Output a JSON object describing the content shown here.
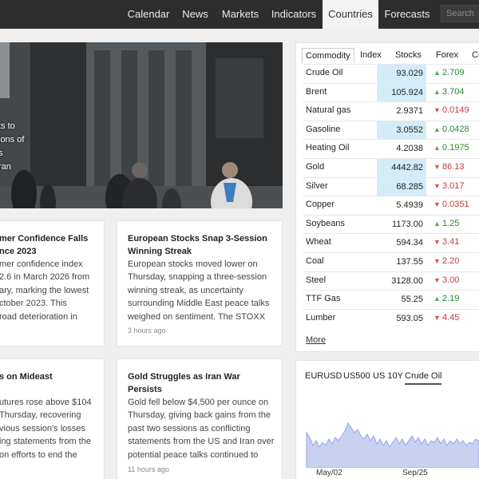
{
  "nav": {
    "items": [
      "Calendar",
      "News",
      "Markets",
      "Indicators",
      "Countries",
      "Forecasts"
    ],
    "active": "Countries",
    "search_placeholder": "Search"
  },
  "hero": {
    "overlay_lines": [
      "ts to",
      "ions of",
      "s",
      "ran"
    ]
  },
  "cards": [
    {
      "title": "mer Confidence Falls\nnce 2023",
      "body": "mer confidence index\n2.6 in March 2026 from\nary, marking the lowest\nctober 2023. This\nroad deterioration in",
      "time": ""
    },
    {
      "title": "European Stocks Snap 3-Session\nWinning Streak",
      "body": "European stocks moved lower on\nThursday, snapping a three-session\nwinning streak, as uncertainty\nsurrounding Middle East peace talks\nweighed on sentiment. The STOXX",
      "time": "3 hours ago"
    },
    {
      "title": "s on Mideast",
      "body": "utures rose above $104\nThursday, recovering\nvious session's losses\ning statements from the\non efforts to end the",
      "time": ""
    },
    {
      "title": "Gold Struggles as Iran War\nPersists",
      "body": "Gold fell below $4,500 per ounce on\nThursday, giving back gains from the\npast two sessions as conflicting\nstatements from the US and Iran over\npotential peace talks continued to",
      "time": "11 hours ago"
    }
  ],
  "commodities": {
    "tabs": [
      "Commodity",
      "Index",
      "Stocks",
      "Forex",
      "Cr"
    ],
    "active_tab": "Commodity",
    "rows": [
      {
        "name": "Crude Oil",
        "price": "93.029",
        "change": "2.709",
        "direction": "up",
        "highlight": true
      },
      {
        "name": "Brent",
        "price": "105.924",
        "change": "3.704",
        "direction": "up",
        "highlight": true
      },
      {
        "name": "Natural gas",
        "price": "2.9371",
        "change": "0.0149",
        "direction": "down",
        "highlight": false
      },
      {
        "name": "Gasoline",
        "price": "3.0552",
        "change": "0.0428",
        "direction": "up",
        "highlight": true
      },
      {
        "name": "Heating Oil",
        "price": "4.2038",
        "change": "0.1975",
        "direction": "up",
        "highlight": false
      },
      {
        "name": "Gold",
        "price": "4442.82",
        "change": "86.13",
        "direction": "down",
        "highlight": true
      },
      {
        "name": "Silver",
        "price": "68.285",
        "change": "3.017",
        "direction": "down",
        "highlight": true
      },
      {
        "name": "Copper",
        "price": "5.4939",
        "change": "0.0351",
        "direction": "down",
        "highlight": false
      },
      {
        "name": "Soybeans",
        "price": "1173.00",
        "change": "1.25",
        "direction": "up",
        "highlight": false
      },
      {
        "name": "Wheat",
        "price": "594.34",
        "change": "3.41",
        "direction": "down",
        "highlight": false
      },
      {
        "name": "Coal",
        "price": "137.55",
        "change": "2.20",
        "direction": "down",
        "highlight": false
      },
      {
        "name": "Steel",
        "price": "3128.00",
        "change": "3.00",
        "direction": "down",
        "highlight": false
      },
      {
        "name": "TTF Gas",
        "price": "55.25",
        "change": "2.19",
        "direction": "up",
        "highlight": false
      },
      {
        "name": "Lumber",
        "price": "593.05",
        "change": "4.45",
        "direction": "down",
        "highlight": false
      }
    ],
    "more_label": "More"
  },
  "chart_panel": {
    "tabs": [
      "EURUSD",
      "US500",
      "US 10Y",
      "Crude Oil"
    ],
    "active_tab": "Crude Oil",
    "x_ticks": [
      "May/02",
      "Sep/25"
    ]
  },
  "colors": {
    "nav_bg": "#2d2d2d",
    "highlight_cell": "#d3ecf8",
    "up": "#2a8a2a",
    "down": "#c23d3d",
    "chart_fill": "#c9d1f0",
    "chart_line": "#97a6e2"
  },
  "icons": [
    "triangle-up-icon",
    "triangle-down-icon"
  ]
}
